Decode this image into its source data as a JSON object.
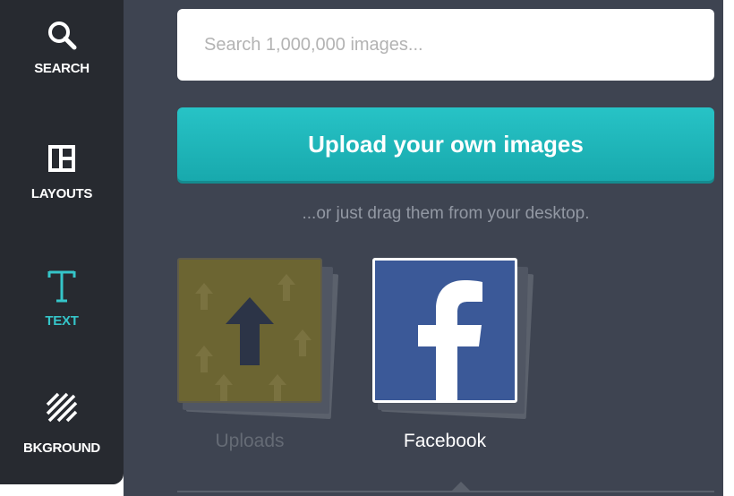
{
  "sidebar": {
    "items": [
      {
        "label": "SEARCH",
        "icon": "search-icon"
      },
      {
        "label": "LAYOUTS",
        "icon": "layouts-icon"
      },
      {
        "label": "TEXT",
        "icon": "text-icon",
        "active": true
      },
      {
        "label": "BKGROUND",
        "icon": "background-icon"
      }
    ]
  },
  "search": {
    "placeholder": "Search 1,000,000 images..."
  },
  "upload": {
    "button_label": "Upload your own images",
    "drag_hint": "...or just drag them from your desktop."
  },
  "sources": [
    {
      "label": "Uploads",
      "icon": "upload-arrow-icon"
    },
    {
      "label": "Facebook",
      "icon": "facebook-icon"
    }
  ],
  "colors": {
    "sidebar_bg": "#272a30",
    "panel_bg": "#3e4451",
    "accent": "#35c5c9",
    "upload_button": "#1fb6ba",
    "facebook_blue": "#3b5998"
  }
}
